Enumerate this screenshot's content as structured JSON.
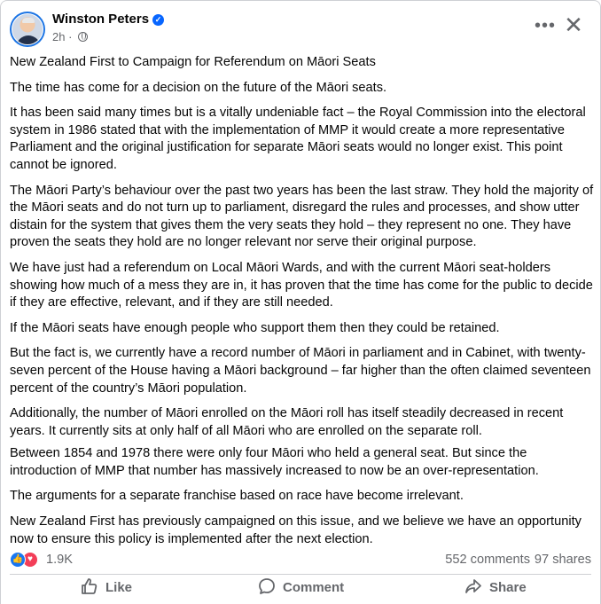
{
  "post": {
    "author": "Winston Peters",
    "time": "2h",
    "paragraphs": [
      "New Zealand First to Campaign for Referendum on Māori Seats",
      "The time has come for a decision on the future of the Māori seats.",
      "It has been said many times but is a vitally undeniable fact – the Royal Commission into the electoral system in 1986 stated that with the implementation of MMP it would create a more representative Parliament and the original justification for separate Māori seats would no longer exist.  This point cannot be ignored.",
      "The Māori Party’s behaviour over the past two years has been the last straw.  They hold the majority of the Māori seats and do not turn up to parliament, disregard the rules and processes, and show utter distain for the system that gives them the very seats they hold – they represent no one.  They have proven the seats they hold are no longer relevant nor serve their original purpose.",
      "We have just had a referendum on Local Māori Wards, and with the current Māori seat-holders showing how much of a mess they are in, it has proven that the time has come for the public to decide if they are effective, relevant, and if they are still needed.",
      "If the Māori seats have enough people who support them then they could be retained.",
      "But the fact is, we currently have a record number of Māori in parliament and in Cabinet, with twenty-seven percent of the House having a Māori background – far higher than the often claimed seventeen percent of the country’s Māori population.",
      "Additionally, the number of Māori enrolled on the Māori roll has itself steadily decreased in recent years.  It currently sits at only half of all Māori who are enrolled on the separate roll.",
      "Between 1854 and 1978 there were only four Māori who held a general seat.  But since the introduction of MMP that number has massively increased to now be an over-representation.",
      "The arguments for a separate franchise based on race have become irrelevant.",
      "New Zealand First has previously campaigned on this issue, and we believe we have an opportunity now to ensure this policy is implemented after the next election."
    ]
  },
  "stats": {
    "reactions": "1.9K",
    "comments": "552 comments",
    "shares": "97 shares"
  },
  "actions": {
    "like": "Like",
    "comment": "Comment",
    "share": "Share"
  },
  "icons": {
    "more": "more-options-icon",
    "close": "close-icon",
    "globe": "globe-icon",
    "verified": "verified-badge-icon"
  },
  "colors": {
    "accent": "#1877f2",
    "love": "#f33e58",
    "secondary_text": "#65676b"
  }
}
